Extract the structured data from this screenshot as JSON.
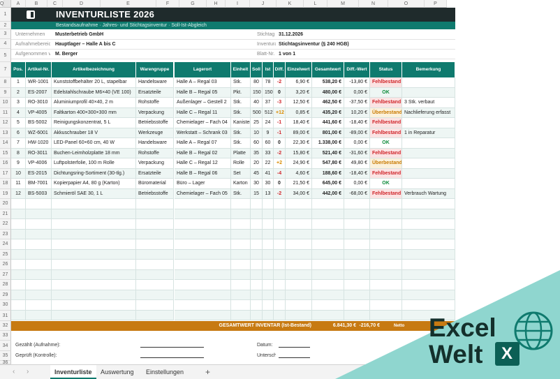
{
  "columns": [
    "A",
    "B",
    "C",
    "D",
    "E",
    "F",
    "G",
    "H",
    "I",
    "J",
    "K",
    "L",
    "M",
    "N",
    "O",
    "P",
    "Q"
  ],
  "row_numbers": [
    "1",
    "2",
    "3",
    "4",
    "5",
    "6",
    "7",
    "8",
    "9",
    "10",
    "11",
    "12",
    "13",
    "14",
    "15",
    "16",
    "17",
    "18",
    "19",
    "20",
    "21",
    "22",
    "23",
    "24",
    "25",
    "26",
    "27",
    "28",
    "29",
    "30",
    "31",
    "32",
    "33",
    "34",
    "35",
    "36"
  ],
  "title": "INVENTURLISTE 2026",
  "subtitle": "Bestandsaufnahme · Jahres- und Stichtagsinventur · Soll-Ist-Abgleich",
  "info": {
    "l1": "Unternehmen",
    "v1": "Musterbetrieb GmbH",
    "l2": "Aufnahmebereich",
    "v2": "Hauptlager – Halle A bis C",
    "l3": "Aufgenommen von",
    "v3": "M. Berger",
    "r1": "Stichtag",
    "rv1": "31.12.2026",
    "r2": "Inventurart",
    "rv2": "Stichtagsinventur (§ 240 HGB)",
    "r3": "Blatt-Nr.",
    "rv3": "1 von 1"
  },
  "table_headers": [
    "Pos.",
    "Artikel-Nr.",
    "Artikelbezeichnung",
    "Warengruppe",
    "Lagerort",
    "Einheit",
    "Soll",
    "Ist",
    "Diff.",
    "Einzelwert",
    "Gesamtwert",
    "Diff.-Wert",
    "Status",
    "Bemerkung"
  ],
  "rows": [
    {
      "pos": "1",
      "nr": "WR-1001",
      "name": "Kunststoffbehälter 20 L, stapelbar",
      "group": "Handelsware",
      "loc": "Halle A – Regal 03",
      "unit": "Stk.",
      "soll": "80",
      "ist": "78",
      "diff": "-2",
      "ew": "6,90 €",
      "gw": "538,20 €",
      "dw": "-13,80 €",
      "status": "Fehlbestand",
      "note": ""
    },
    {
      "pos": "2",
      "nr": "ES-2007",
      "name": "Edelstahlschraube M6×40 (VE 100)",
      "group": "Ersatzteile",
      "loc": "Halle B – Regal 05",
      "unit": "Pkt.",
      "soll": "150",
      "ist": "150",
      "diff": "0",
      "ew": "3,20 €",
      "gw": "480,00 €",
      "dw": "0,00 €",
      "status": "OK",
      "note": ""
    },
    {
      "pos": "3",
      "nr": "RO-3010",
      "name": "Aluminiumprofil 40×40, 2 m",
      "group": "Rohstoffe",
      "loc": "Außenlager – Gestell 2",
      "unit": "Stk.",
      "soll": "40",
      "ist": "37",
      "diff": "-3",
      "ew": "12,50 €",
      "gw": "462,50 €",
      "dw": "-37,50 €",
      "status": "Fehlbestand",
      "note": "3 Stk. verbaut"
    },
    {
      "pos": "4",
      "nr": "VP-4005",
      "name": "Faltkarton 400×300×300 mm",
      "group": "Verpackung",
      "loc": "Halle C – Regal 11",
      "unit": "Stk.",
      "soll": "500",
      "ist": "512",
      "diff": "+12",
      "ew": "0,85 €",
      "gw": "435,20 €",
      "dw": "10,20 €",
      "status": "Überbestand",
      "note": "Nachlieferung erfasst"
    },
    {
      "pos": "5",
      "nr": "BS-5002",
      "name": "Reinigungskonzentrat, 5 L",
      "group": "Betriebsstoffe",
      "loc": "Chemielager – Fach 04",
      "unit": "Kanister",
      "soll": "25",
      "ist": "24",
      "diff": "-1",
      "ew": "18,40 €",
      "gw": "441,60 €",
      "dw": "-18,40 €",
      "status": "Fehlbestand",
      "note": ""
    },
    {
      "pos": "6",
      "nr": "WZ-6001",
      "name": "Akkuschrauber 18 V",
      "group": "Werkzeuge",
      "loc": "Werkstatt – Schrank 03",
      "unit": "Stk.",
      "soll": "10",
      "ist": "9",
      "diff": "-1",
      "ew": "89,00 €",
      "gw": "801,00 €",
      "dw": "-89,00 €",
      "status": "Fehlbestand",
      "note": "1 in Reparatur"
    },
    {
      "pos": "7",
      "nr": "HW-1020",
      "name": "LED-Panel 60×60 cm, 40 W",
      "group": "Handelsware",
      "loc": "Halle A – Regal 07",
      "unit": "Stk.",
      "soll": "60",
      "ist": "60",
      "diff": "0",
      "ew": "22,30 €",
      "gw": "1.338,00 €",
      "dw": "0,00 €",
      "status": "OK",
      "note": ""
    },
    {
      "pos": "8",
      "nr": "RO-3011",
      "name": "Buchen-Leimholzplatte 18 mm",
      "group": "Rohstoffe",
      "loc": "Halle B – Regal 02",
      "unit": "Platte",
      "soll": "35",
      "ist": "33",
      "diff": "-2",
      "ew": "15,80 €",
      "gw": "521,40 €",
      "dw": "-31,60 €",
      "status": "Fehlbestand",
      "note": ""
    },
    {
      "pos": "9",
      "nr": "VP-4006",
      "name": "Luftpolsterfolie, 100 m Rolle",
      "group": "Verpackung",
      "loc": "Halle C – Regal 12",
      "unit": "Rolle",
      "soll": "20",
      "ist": "22",
      "diff": "+2",
      "ew": "24,90 €",
      "gw": "547,80 €",
      "dw": "49,80 €",
      "status": "Überbestand",
      "note": ""
    },
    {
      "pos": "10",
      "nr": "ES-2015",
      "name": "Dichtungsring-Sortiment (30-tlg.)",
      "group": "Ersatzteile",
      "loc": "Halle B – Regal 06",
      "unit": "Set",
      "soll": "45",
      "ist": "41",
      "diff": "-4",
      "ew": "4,60 €",
      "gw": "188,60 €",
      "dw": "-18,40 €",
      "status": "Fehlbestand",
      "note": ""
    },
    {
      "pos": "11",
      "nr": "BM-7001",
      "name": "Kopierpapier A4, 80 g (Karton)",
      "group": "Büromaterial",
      "loc": "Büro – Lager",
      "unit": "Karton",
      "soll": "30",
      "ist": "30",
      "diff": "0",
      "ew": "21,50 €",
      "gw": "645,00 €",
      "dw": "0,00 €",
      "status": "OK",
      "note": ""
    },
    {
      "pos": "12",
      "nr": "BS-5003",
      "name": "Schmieröl SAE 30, 1 L",
      "group": "Betriebsstoffe",
      "loc": "Chemielager – Fach 05",
      "unit": "Stk.",
      "soll": "15",
      "ist": "13",
      "diff": "-2",
      "ew": "34,00 €",
      "gw": "442,00 €",
      "dw": "-68,00 €",
      "status": "Fehlbestand",
      "note": "Verbrauch Wartung"
    }
  ],
  "totals": {
    "label": "GESAMTWERT INVENTAR (Ist-Bestand)",
    "gesamt": "6.841,30 €",
    "diff": "-216,70 €",
    "extra": "Netto"
  },
  "signatures": {
    "l1": "Gezählt (Aufnahme):",
    "l2": "Geprüft (Kontrolle):",
    "d1": "Datum:",
    "d2": "Unterschrift:"
  },
  "tabs": [
    "Inventurliste",
    "Auswertung",
    "Einstellungen"
  ],
  "add_sheet": "+",
  "watermark": {
    "line1": "Excel",
    "line2": "Welt",
    "badge": "X"
  },
  "colors": {
    "teal": "#0f7a6e",
    "dark": "#1f2b2c",
    "orange": "#c77a12",
    "watermark_bg": "#8fd6cf"
  }
}
